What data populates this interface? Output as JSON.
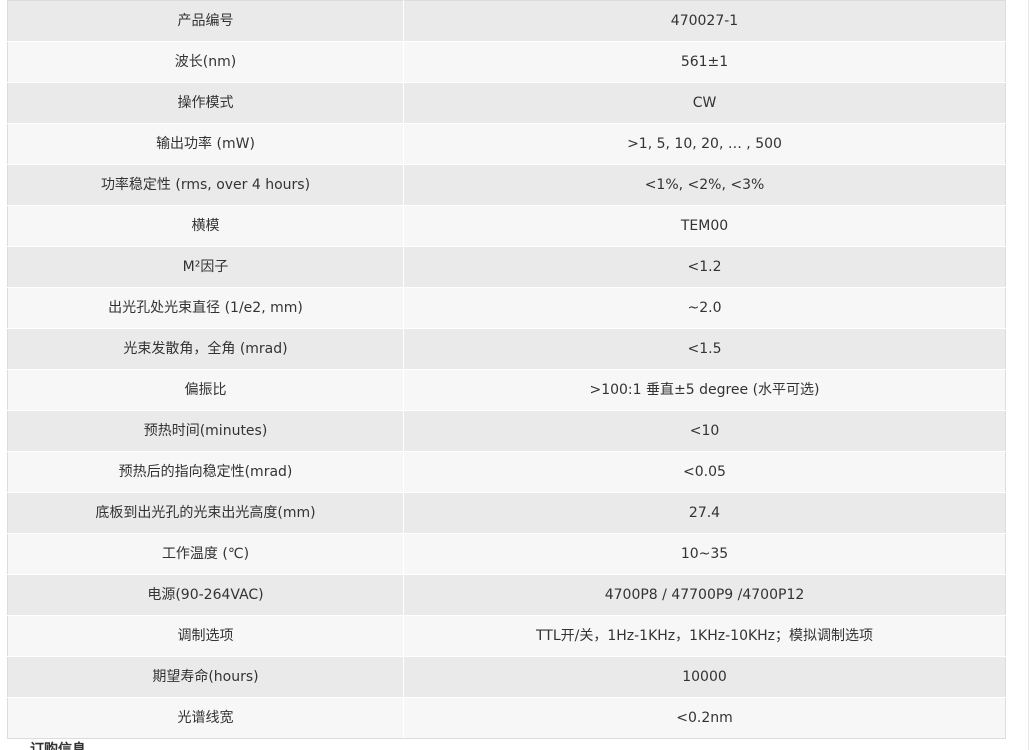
{
  "spec_table": {
    "rows": [
      {
        "label": "产品编号",
        "value": "470027-1"
      },
      {
        "label": "波长(nm)",
        "value": "561±1"
      },
      {
        "label": "操作模式",
        "value": "CW"
      },
      {
        "label": "输出功率 (mW)",
        "value": ">1, 5, 10, 20, … , 500"
      },
      {
        "label": "功率稳定性  (rms, over 4 hours)",
        "value": "<1%, <2%, <3%"
      },
      {
        "label": "横模",
        "value": "TEM00"
      },
      {
        "label": "M²因子",
        "value": "<1.2"
      },
      {
        "label": "出光孔处光束直径 (1/e2, mm)",
        "value": "~2.0"
      },
      {
        "label": "光束发散角，全角 (mrad)",
        "value": "<1.5"
      },
      {
        "label": "偏振比",
        "value": ">100:1 垂直±5 degree (水平可选)"
      },
      {
        "label": "预热时间(minutes)",
        "value": "<10"
      },
      {
        "label": "预热后的指向稳定性(mrad)",
        "value": "<0.05"
      },
      {
        "label": "底板到出光孔的光束出光高度(mm)",
        "value": "27.4"
      },
      {
        "label": "工作温度 (℃)",
        "value": "10~35"
      },
      {
        "label": "电源(90-264VAC)",
        "value": "4700P8 / 47700P9 /4700P12"
      },
      {
        "label": "调制选项",
        "value": "TTL开/关，1Hz-1KHz，1KHz-10KHz；模拟调制选项"
      },
      {
        "label": "期望寿命(hours)",
        "value": "10000"
      },
      {
        "label": "光谱线宽",
        "value": "<0.2nm"
      }
    ]
  },
  "footer": {
    "cutoff_heading": "订购信息"
  }
}
